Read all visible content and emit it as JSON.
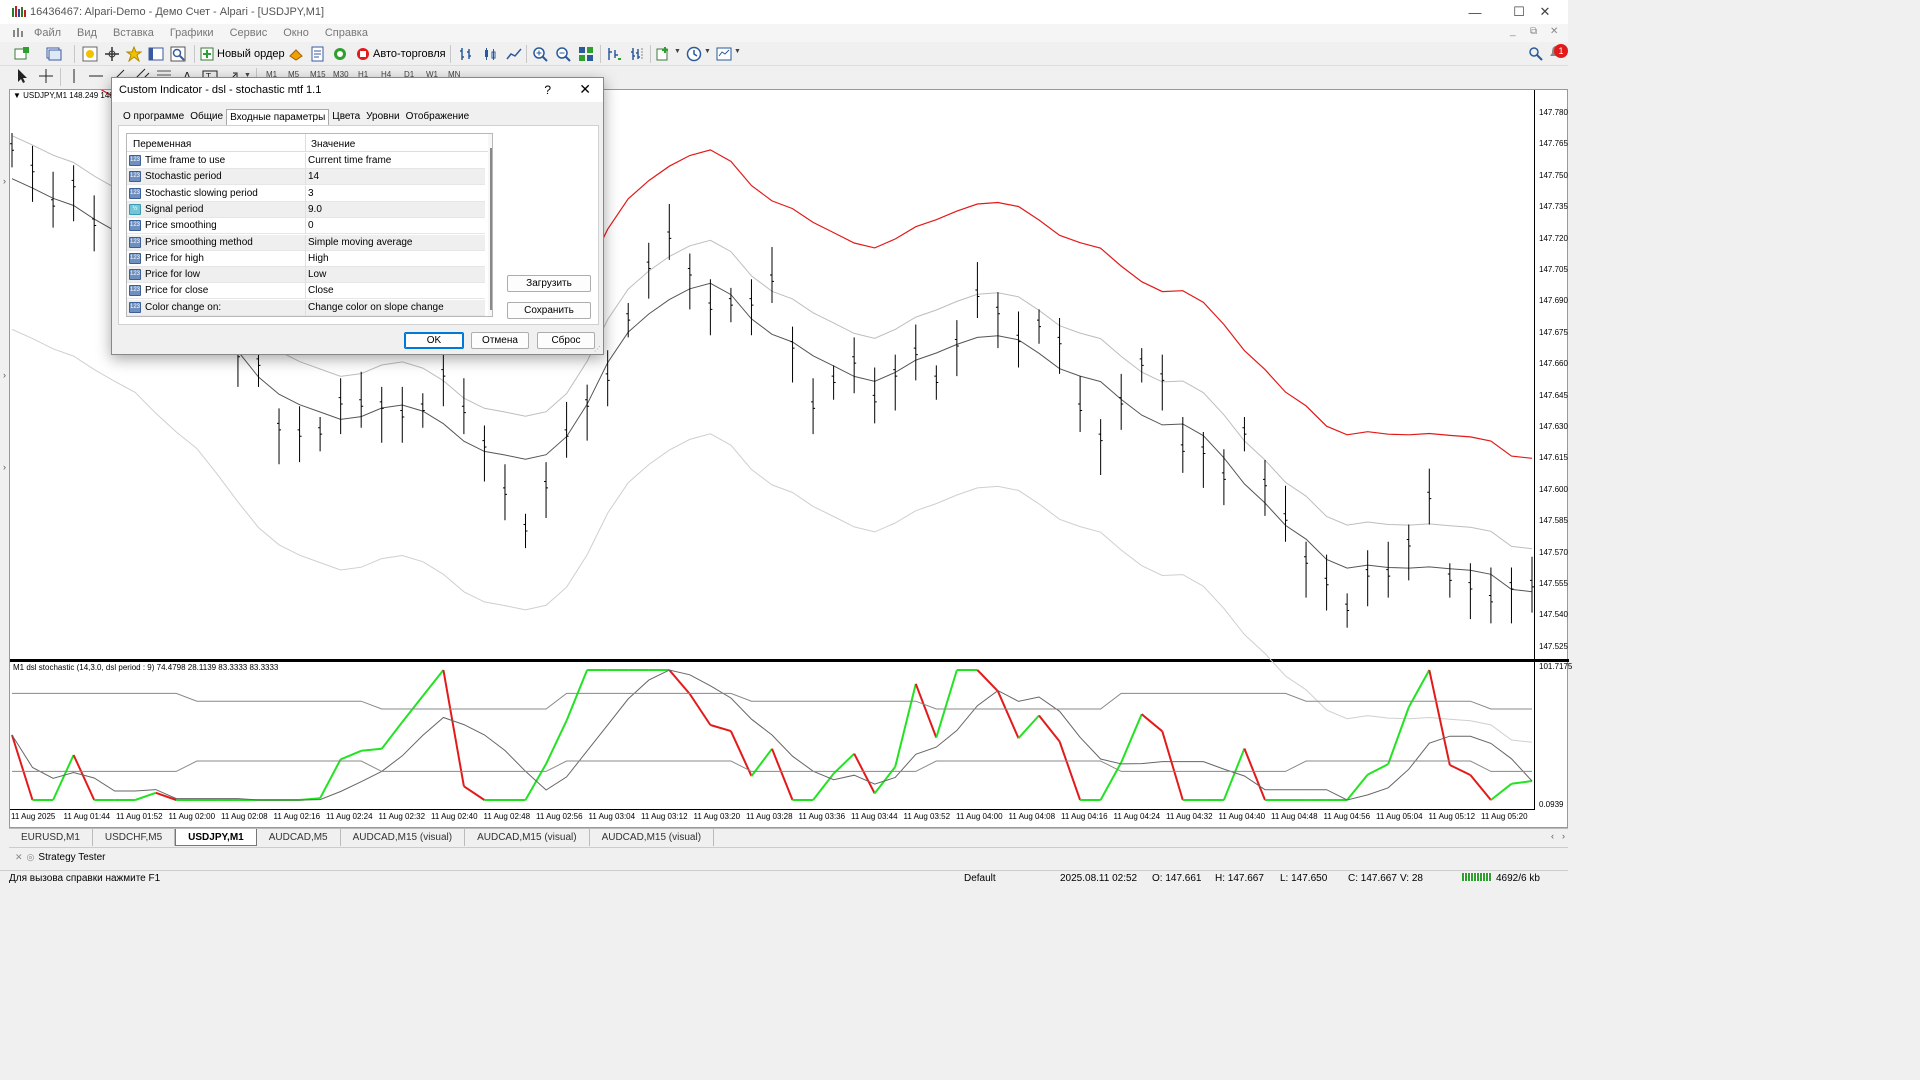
{
  "window": {
    "title": "16436467: Alpari-Demo - Демо Счет - Alpari - [USDJPY,M1]",
    "minimize": "—",
    "maximize": "☐",
    "close": "✕"
  },
  "menu": {
    "items": [
      "Файл",
      "Вид",
      "Вставка",
      "Графики",
      "Сервис",
      "Окно",
      "Справка"
    ],
    "mdi_controls": [
      "_",
      "⧉",
      "✕"
    ]
  },
  "toolbar": {
    "new_order": "Новый ордер",
    "autotrading": "Авто-торговля",
    "timeframes": [
      "M1",
      "M5",
      "M15",
      "M30",
      "H1",
      "H4",
      "D1",
      "W1",
      "MN"
    ],
    "notification_count": "1"
  },
  "chart": {
    "symbol_label": "USDJPY,M1  148.249  148",
    "indicator_label": "M1 dsl stochastic (14,3.0, dsl period : 9) 74.4798 28.1139 83.3333 83.3333",
    "indicator_top_value": "101.7175",
    "indicator_bottom_value": "0.0939",
    "price_ticks": [
      "147.780",
      "147.765",
      "147.750",
      "147.735",
      "147.720",
      "147.705",
      "147.690",
      "147.675",
      "147.660",
      "147.645",
      "147.630",
      "147.615",
      "147.600",
      "147.585",
      "147.570",
      "147.555",
      "147.540",
      "147.525"
    ],
    "time_ticks": [
      "11 Aug 2025",
      "11 Aug 01:44",
      "11 Aug 01:52",
      "11 Aug 02:00",
      "11 Aug 02:08",
      "11 Aug 02:16",
      "11 Aug 02:24",
      "11 Aug 02:32",
      "11 Aug 02:40",
      "11 Aug 02:48",
      "11 Aug 02:56",
      "11 Aug 03:04",
      "11 Aug 03:12",
      "11 Aug 03:20",
      "11 Aug 03:28",
      "11 Aug 03:36",
      "11 Aug 03:44",
      "11 Aug 03:52",
      "11 Aug 04:00",
      "11 Aug 04:08",
      "11 Aug 04:16",
      "11 Aug 04:24",
      "11 Aug 04:32",
      "11 Aug 04:40",
      "11 Aug 04:48",
      "11 Aug 04:56",
      "11 Aug 05:04",
      "11 Aug 05:12",
      "11 Aug 05:20"
    ],
    "colors": {
      "upper_band": "#e31a1a",
      "stoch_up": "#22e322",
      "stoch_down": "#e31a1a"
    }
  },
  "chart_data": {
    "type": "line",
    "title": "USDJPY,M1",
    "ylim": [
      147.52,
      147.785
    ],
    "series": [
      {
        "name": "",
        "values": [
          147.757,
          147.747,
          147.731,
          147.74,
          147.722,
          147.711,
          147.711,
          147.713,
          147.709,
          147.695,
          147.672,
          147.661,
          147.657,
          147.627,
          147.624,
          147.625,
          147.639,
          147.638,
          147.637,
          147.633,
          147.636,
          147.652,
          147.635,
          147.619,
          147.597,
          147.58,
          147.6,
          147.624,
          147.638,
          147.65,
          147.678,
          147.702,
          147.716,
          147.699,
          147.683,
          147.685,
          147.685,
          147.696,
          147.665,
          147.637,
          147.649,
          147.658,
          147.64,
          147.652,
          147.662,
          147.649,
          147.666,
          147.689,
          147.681,
          147.668,
          147.675,
          147.667,
          147.636,
          147.622,
          147.639,
          147.657,
          147.65,
          147.617,
          147.616,
          147.604,
          147.625,
          147.601,
          147.585,
          147.565,
          147.555,
          147.543,
          147.559,
          147.559,
          147.573,
          147.595,
          147.557,
          147.553,
          147.547,
          147.553,
          147.554
        ]
      }
    ]
  },
  "tabs": {
    "items": [
      "EURUSD,M1",
      "USDCHF,M5",
      "USDJPY,M1",
      "AUDCAD,M5",
      "AUDCAD,M15 (visual)",
      "AUDCAD,M15 (visual)",
      "AUDCAD,M15 (visual)"
    ],
    "active_index": 2
  },
  "strategy_tester": {
    "label": "Strategy Tester"
  },
  "status": {
    "help": "Для вызова справки нажмите F1",
    "profile": "Default",
    "time": "2025.08.11 02:52",
    "open": "O: 147.661",
    "high": "H: 147.667",
    "low": "L: 147.650",
    "close": "C: 147.667",
    "volume": "V: 28",
    "traffic": "4692/6 kb"
  },
  "dialog": {
    "title": "Custom Indicator - dsl - stochastic mtf 1.1",
    "help": "?",
    "close": "✕",
    "tabs": [
      "О программе",
      "Общие",
      "Входные параметры",
      "Цвета",
      "Уровни",
      "Отображение"
    ],
    "active_tab": 2,
    "col_variable": "Переменная",
    "col_value": "Значение",
    "params": [
      {
        "name": "Time frame to use",
        "value": "Current time frame",
        "icon": "123"
      },
      {
        "name": "Stochastic period",
        "value": "14",
        "icon": "123"
      },
      {
        "name": "Stochastic slowing period",
        "value": "3",
        "icon": "123"
      },
      {
        "name": "Signal period",
        "value": "9.0",
        "icon": "½"
      },
      {
        "name": "Price smoothing",
        "value": "0",
        "icon": "123"
      },
      {
        "name": "Price smoothing method",
        "value": "Simple moving average",
        "icon": "123"
      },
      {
        "name": "Price for high",
        "value": "High",
        "icon": "123"
      },
      {
        "name": "Price for low",
        "value": "Low",
        "icon": "123"
      },
      {
        "name": "Price for close",
        "value": "Close",
        "icon": "123"
      },
      {
        "name": "Color change on:",
        "value": "Change color on slope change",
        "icon": "123"
      }
    ],
    "load": "Загрузить",
    "save": "Сохранить",
    "ok": "OK",
    "cancel": "Отмена",
    "reset": "Сброс"
  }
}
